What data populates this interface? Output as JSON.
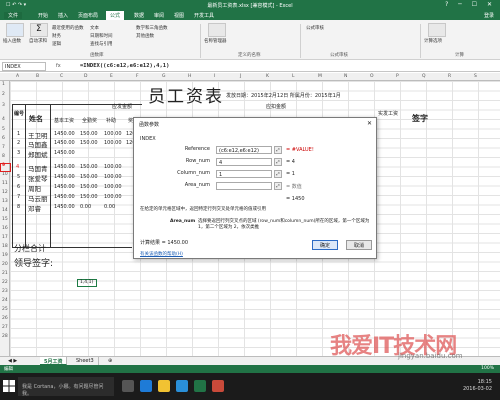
{
  "titlebar": {
    "title": "最新员工资表.xlsx [兼容模式] - Excel",
    "quick": "☐ ↶ ↷ ▾",
    "winctrl": "? ─ ☐ ✕"
  },
  "tabs": [
    {
      "label": "文件"
    },
    {
      "label": "开始"
    },
    {
      "label": "插入"
    },
    {
      "label": "页面布局"
    },
    {
      "label": "公式",
      "active": true
    },
    {
      "label": "数据"
    },
    {
      "label": "审阅"
    },
    {
      "label": "视图"
    },
    {
      "label": "开发工具"
    }
  ],
  "signin": "登录",
  "ribbon": {
    "items": [
      "插入函数",
      "自动求和",
      "最近使用的函数",
      "财务",
      "逻辑",
      "文本",
      "日期和时间",
      "查找与引用",
      "数学和三角函数",
      "其他函数",
      "名称管理器",
      "定义的名称",
      "公式审核",
      "计算选项",
      "计算"
    ],
    "groups": [
      "函数库",
      "定义的名称",
      "公式审核",
      "计算"
    ]
  },
  "formula_bar": {
    "namebox": "INDEX",
    "fx": "fx",
    "formula": "=INDEX((c6:e12,e6:e12),4,1)"
  },
  "columns": [
    "A",
    "B",
    "C",
    "D",
    "E",
    "F",
    "G",
    "H",
    "I",
    "J",
    "K",
    "L",
    "M",
    "N",
    "O",
    "P",
    "Q",
    "R",
    "S"
  ],
  "rows": [
    "1",
    "2",
    "3",
    "4",
    "5",
    "6",
    "7",
    "8",
    "9",
    "10",
    "11",
    "12",
    "13",
    "14",
    "15",
    "16",
    "17",
    "18",
    "19",
    "20",
    "21",
    "22",
    "23",
    "24",
    "25",
    "26",
    "27",
    "28"
  ],
  "sheet": {
    "title": "员工资表",
    "subtitle": "发放日期：2015年2月12日  所属月份：2015年1月",
    "headers": {
      "num": "编号",
      "name": "姓名",
      "pay": "应发金额",
      "base": "基本工资",
      "bonus": "全勤奖",
      "allow": "补助",
      "extra": "奖金",
      "deduct": "应扣金额",
      "net": "实发工资",
      "sign": "签字"
    },
    "employees": [
      {
        "no": "1",
        "name": "王卫明",
        "base": "1450.00",
        "bonus": "150.00",
        "allow": "100.00",
        "extra": "1200.00"
      },
      {
        "no": "2",
        "name": "马国鑫",
        "base": "1450.00",
        "bonus": "150.00",
        "allow": "100.00",
        "extra": "1200.00"
      },
      {
        "no": "3",
        "name": "郑国斌",
        "base": "1450.00",
        "bonus": "",
        "allow": "",
        "extra": ""
      },
      {
        "no": "4",
        "name": "马国青",
        "base": "1450.00",
        "bonus": "150.00",
        "allow": "100.00",
        "extra": ""
      },
      {
        "no": "5",
        "name": "张爱琴",
        "base": "1450.00",
        "bonus": "150.00",
        "allow": "100.00",
        "extra": ""
      },
      {
        "no": "6",
        "name": "周阳",
        "base": "1450.00",
        "bonus": "150.00",
        "allow": "100.00",
        "extra": ""
      },
      {
        "no": "7",
        "name": "马云丽",
        "base": "1450.00",
        "bonus": "150.00",
        "allow": "100.00",
        "extra": ""
      },
      {
        "no": "8",
        "name": "邓睿",
        "base": "1450.00",
        "bonus": "0.00",
        "allow": "0.00",
        "extra": ""
      }
    ],
    "subtotal": "分栏合计",
    "leader": "领导签字:",
    "active_cell": "1,4,1)"
  },
  "dialog": {
    "title": "函数参数",
    "close": "✕",
    "fn": "INDEX",
    "args": [
      {
        "label": "Reference",
        "value": "(c6:e12,e6:e12)",
        "result": "= #VALUE!"
      },
      {
        "label": "Row_num",
        "value": "4",
        "result": "= 4"
      },
      {
        "label": "Column_num",
        "value": "1",
        "result": "= 1"
      },
      {
        "label": "Area_num",
        "value": "",
        "result": "= 数值"
      }
    ],
    "result2": "= 1450",
    "desc": "在给定的单元格区域中，返回特定行列交叉处单元格的值或引用",
    "row_label": "Area_num",
    "row_desc": "选择要返回行列交叉点的区域 (row_num和column_num)所在的区域，第一个区域为 1，第二个区域为 2，依次类推",
    "calc": "计算结果 = 1450.00",
    "help": "有关该函数的帮助(H)",
    "ok": "确定",
    "cancel": "取消"
  },
  "sheettabs": [
    "5月工资",
    "Sheet3"
  ],
  "status": {
    "mode": "编辑",
    "zoom": "100%"
  },
  "taskbar": {
    "search": "我是 Cortana，小娜。有问题尽管问我。",
    "time": "18:15",
    "date": "2016-03-02"
  },
  "watermark": {
    "text": "我爱IT技术网",
    "url": "jingyan.baidu.com"
  }
}
